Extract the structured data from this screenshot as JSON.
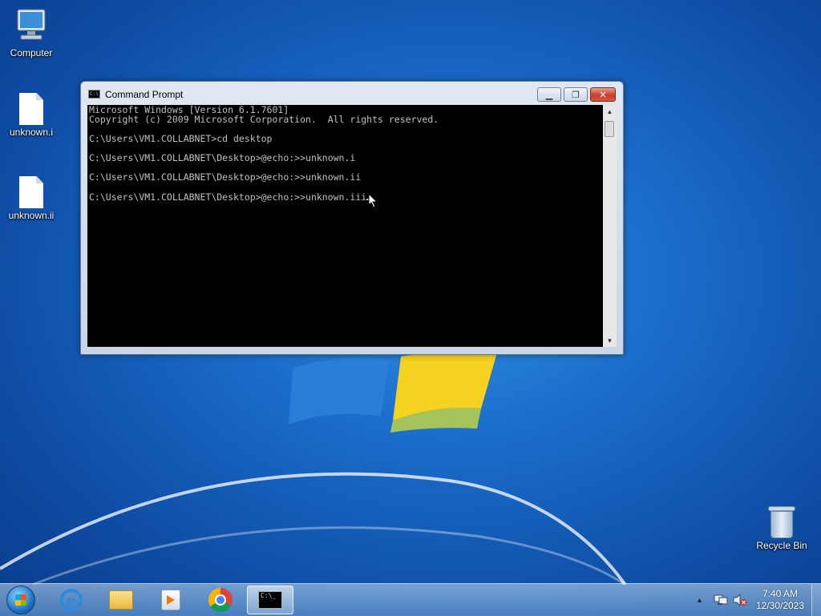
{
  "desktop_icons": {
    "computer": {
      "label": "Computer",
      "icon": "computer-icon"
    },
    "file1": {
      "label": "unknown.i",
      "icon": "file-icon"
    },
    "file2": {
      "label": "unknown.ii",
      "icon": "file-icon"
    },
    "recycle_bin": {
      "label": "Recycle Bin",
      "icon": "recycle-bin-icon"
    }
  },
  "cmd_window": {
    "title": "Command Prompt",
    "icon": "cmd-icon",
    "controls": {
      "minimize": "minimize-icon",
      "maximize": "maximize-icon",
      "close": "close-icon"
    },
    "lines": [
      "Microsoft Windows [Version 6.1.7601]",
      "Copyright (c) 2009 Microsoft Corporation.  All rights reserved.",
      "",
      "C:\\Users\\VM1.COLLABNET>cd desktop",
      "",
      "C:\\Users\\VM1.COLLABNET\\Desktop>@echo:>>unknown.i",
      "",
      "C:\\Users\\VM1.COLLABNET\\Desktop>@echo:>>unknown.ii",
      "",
      "C:\\Users\\VM1.COLLABNET\\Desktop>@echo:>>unknown.iii"
    ]
  },
  "taskbar": {
    "start": "windows-start-icon",
    "pinned": [
      {
        "name": "internet-explorer",
        "icon": "internet-explorer-icon"
      },
      {
        "name": "file-explorer",
        "icon": "folder-icon"
      },
      {
        "name": "media-player",
        "icon": "media-player-icon"
      },
      {
        "name": "chrome",
        "icon": "chrome-icon"
      },
      {
        "name": "command-prompt",
        "icon": "cmd-icon",
        "active": true
      }
    ],
    "tray": {
      "hidden_icons": "chevron-up-icon",
      "network": "network-icon",
      "volume": "volume-muted-icon"
    },
    "clock": {
      "time": "7:40 AM",
      "date": "12/30/2023"
    }
  },
  "colors": {
    "desktop": "#1a6cc9",
    "console_bg": "#000000",
    "console_text": "#c0c0c0",
    "close_button": "#c6412a"
  }
}
